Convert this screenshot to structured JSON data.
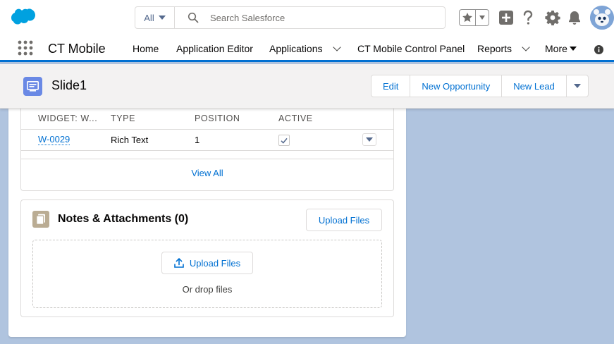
{
  "header": {
    "search": {
      "scope": "All",
      "placeholder": "Search Salesforce"
    }
  },
  "nav": {
    "app_name": "CT Mobile",
    "items": [
      {
        "label": "Home"
      },
      {
        "label": "Application Editor"
      },
      {
        "label": "Applications"
      },
      {
        "label": "CT Mobile Control Panel"
      },
      {
        "label": "Reports"
      },
      {
        "label": "More"
      }
    ]
  },
  "record": {
    "title": "Slide1",
    "actions": [
      {
        "label": "Edit"
      },
      {
        "label": "New Opportunity"
      },
      {
        "label": "New Lead"
      }
    ]
  },
  "widgets": {
    "columns": [
      "WIDGET: W...",
      "TYPE",
      "POSITION",
      "ACTIVE"
    ],
    "rows": [
      {
        "name": "W-0029",
        "type": "Rich Text",
        "position": "1",
        "active": true
      }
    ],
    "view_all": "View All"
  },
  "notes": {
    "title": "Notes & Attachments (0)",
    "upload_label": "Upload Files",
    "drop_upload_label": "Upload Files",
    "drop_text": "Or drop files"
  },
  "colors": {
    "brand": "#0070d2",
    "background": "#b0c4df",
    "record_icon": "#6a89e5",
    "notes_icon": "#baac93"
  },
  "icons": [
    "salesforce-cloud-icon",
    "search-icon",
    "star-icon",
    "plus-icon",
    "help-icon",
    "gear-icon",
    "bell-icon",
    "app-launcher-icon",
    "info-icon",
    "record-icon",
    "notes-icon",
    "upload-icon",
    "checkmark-icon"
  ]
}
